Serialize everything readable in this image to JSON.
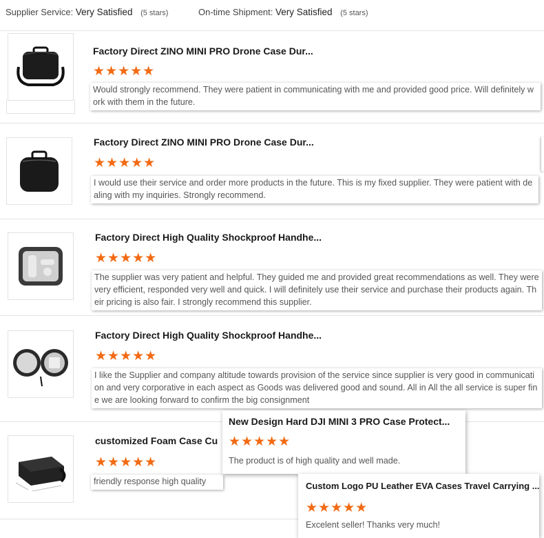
{
  "summary": {
    "supplier_label": "Supplier Service:",
    "supplier_value": "Very Satisfied",
    "supplier_stars": "(5 stars)",
    "shipment_label": "On-time Shipment:",
    "shipment_value": "Very Satisfied",
    "shipment_stars": "(5 stars)"
  },
  "colors": {
    "star": "#f26a13",
    "divider": "#e3e3e3"
  },
  "reviews": [
    {
      "title": "Factory Direct ZINO MINI PRO Drone Case Dur...",
      "rating": 5,
      "comment": "Would strongly recommend. They were patient in communicating with me and provided good price. Will definitely work with them in the future.",
      "thumb_icon": "black-shoulder-bag-icon"
    },
    {
      "title": "Factory Direct ZINO MINI PRO Drone Case Dur...",
      "rating": 5,
      "comment": "I would use their service and order more products in the future. This is my fixed supplier. They were patient with dealing with my inquiries. Strongly recommend.",
      "thumb_icon": "black-square-case-icon"
    },
    {
      "title": "Factory Direct High Quality Shockproof Handhe...",
      "rating": 5,
      "comment": "The supplier was very patient and helpful. They guided me and provided great recommendations as well. They were very efficient, responded very well and quick. I will definitely use their service and purchase their products again. Their pricing is also fair. I strongly recommend this supplier.",
      "thumb_icon": "open-gimbal-case-icon"
    },
    {
      "title": "Factory Direct High Quality Shockproof Handhe...",
      "rating": 5,
      "comment": "I like the Supplier and company altitude towards provision of the service since supplier is very good in communication and very corporative in each aspect as Goods was delivered good and sound. All in All the all service is super fine we are looking forward to confirm the big consignment",
      "thumb_icon": "open-round-case-icon"
    },
    {
      "title": "customized Foam Case Cu",
      "rating": 5,
      "comment": "friendly response high quality",
      "thumb_icon": "hard-case-with-handle-icon"
    }
  ],
  "popups": [
    {
      "title": "New Design Hard DJI MINI 3 PRO Case Protect...",
      "rating": 5,
      "comment": "The product is of high quality and well made."
    },
    {
      "title": "Custom Logo PU Leather EVA Cases Travel Carrying ...",
      "rating": 5,
      "comment": "Excelent seller! Thanks very much!"
    }
  ],
  "star_glyphs": "★★★★★"
}
